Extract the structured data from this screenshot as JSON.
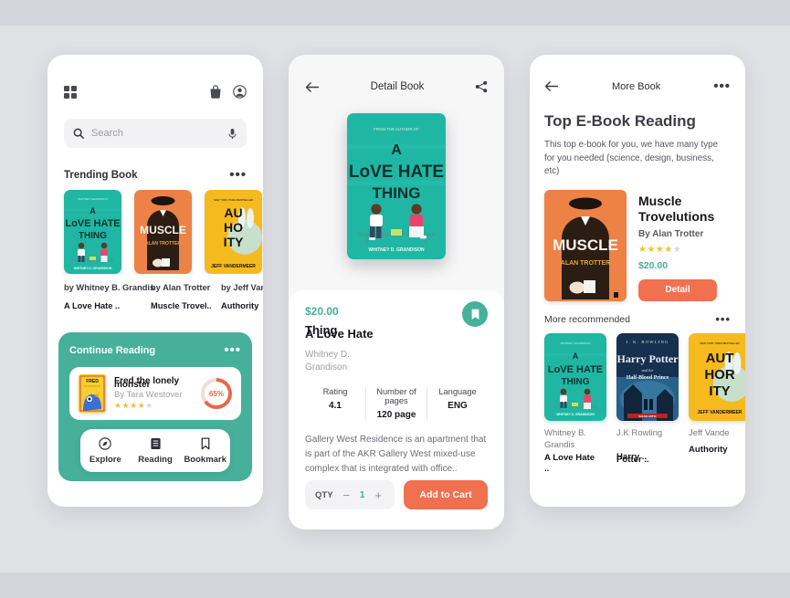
{
  "theme": {
    "teal": "#46b09a",
    "orange": "#f0704f",
    "page_bg": "#d5d5dd",
    "inner_bg": "#e0e1e5",
    "star_on": "#f5c02e",
    "star_off": "#d8d8dd"
  },
  "screen1": {
    "topbar": {
      "grid_icon": "grid-icon",
      "bag_icon": "shopping-bag-icon",
      "account_icon": "account-circle-icon"
    },
    "search": {
      "placeholder": "Search",
      "search_icon": "search-icon",
      "mic_icon": "microphone-icon"
    },
    "trending": {
      "title": "Trending Book",
      "more_icon": "more-horizontal-icon",
      "books": [
        {
          "cover": "a-love-hate-thing",
          "author": "by Whitney B. Grandis",
          "title": "A Love Hate .."
        },
        {
          "cover": "muscle",
          "author": "by Alan Trotter",
          "title": "Muscle Trovel.."
        },
        {
          "cover": "authority",
          "author": "by Jeff Van",
          "title": "Authority"
        }
      ]
    },
    "continue": {
      "title": "Continue Reading",
      "more_icon": "more-horizontal-icon",
      "book": {
        "cover": "fred-the-lonely-monster",
        "title_line1": "Fred the lonely",
        "title_line2": "monster",
        "author": "By Tara Westover",
        "stars_filled": 4,
        "stars_total": 5,
        "progress": "65%"
      }
    },
    "nav": [
      {
        "icon": "compass-icon",
        "label": "Explore"
      },
      {
        "icon": "book-icon",
        "label": "Reading"
      },
      {
        "icon": "bookmark-icon",
        "label": "Bookmark"
      }
    ]
  },
  "screen2": {
    "topbar": {
      "back_icon": "arrow-left-icon",
      "title": "Detail Book",
      "share_icon": "share-icon"
    },
    "hero_cover": "a-love-hate-thing",
    "price": "$20.00",
    "title_line1": "Thing",
    "title_line2": "A Love Hate",
    "author_line1": "Whitney D.",
    "author_line2": "Grandison",
    "bookmark_icon": "bookmark-icon",
    "specs": [
      {
        "key": "Rating",
        "value": "4.1"
      },
      {
        "key": "Number of pages",
        "value": "120 page"
      },
      {
        "key": "Language",
        "value": "ENG"
      }
    ],
    "description": "Gallery West Residence is an apartment that is part of the AKR Gallery West mixed-use complex that is integrated with office..",
    "qty": {
      "label": "QTY",
      "minus": "−",
      "value": "1",
      "plus": "+"
    },
    "add_to_cart": "Add to Cart"
  },
  "screen3": {
    "topbar": {
      "back_icon": "arrow-left-icon",
      "title": "More Book",
      "more_icon": "more-horizontal-icon"
    },
    "heading": "Top E-Book Reading",
    "subtitle": "This top e-book for you, we have many type for you needed (science, design, business, etc)",
    "featured": {
      "cover": "muscle",
      "title": "Muscle Trovelutions",
      "author": "By Alan Trotter",
      "stars_filled": 4,
      "stars_total": 5,
      "price": "$20.00",
      "detail_button": "Detail"
    },
    "recommended": {
      "title": "More recommended",
      "more_icon": "more-horizontal-icon",
      "books": [
        {
          "cover": "a-love-hate-thing",
          "author": "Whitney B. Grandis",
          "title_line1": "A Love Hate",
          "title_line2": ".."
        },
        {
          "cover": "harry-potter",
          "author": "J.K Rowling",
          "title_line1": "Harry ..",
          "title_line2": "Potter .."
        },
        {
          "cover": "authority",
          "author": "Jeff Vande",
          "title_line1": "Authority",
          "title_line2": ""
        }
      ]
    }
  }
}
